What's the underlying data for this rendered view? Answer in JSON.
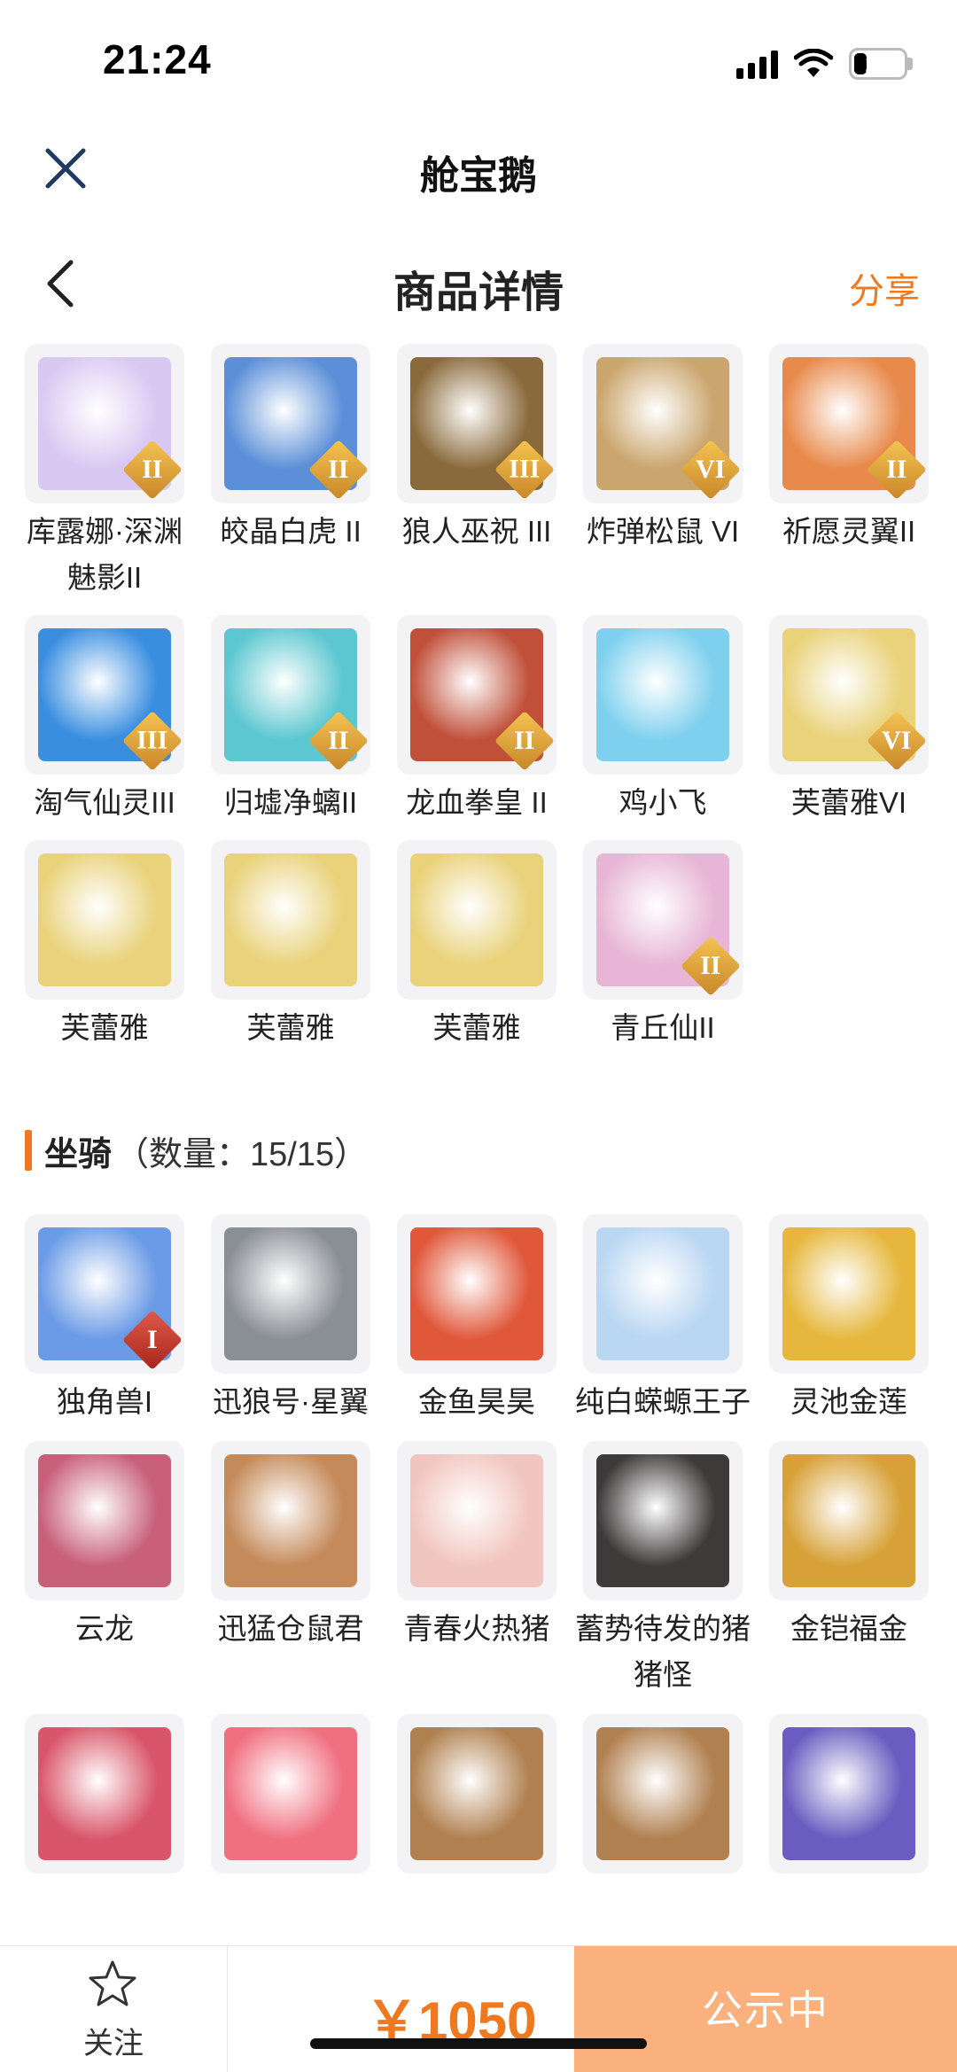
{
  "status": {
    "time": "21:24",
    "battery": "27"
  },
  "app": {
    "title": "舱宝鹅"
  },
  "nav": {
    "title": "商品详情",
    "share": "分享"
  },
  "pets": [
    {
      "name": "库露娜·深渊魅影II",
      "badge": "II",
      "icon": "pet-portrait",
      "color": "#d9c8f2"
    },
    {
      "name": "皎晶白虎 II",
      "badge": "II",
      "icon": "pet-portrait",
      "color": "#5b8fd8"
    },
    {
      "name": "狼人巫祝 III",
      "badge": "III",
      "icon": "pet-portrait",
      "color": "#8a6a3c"
    },
    {
      "name": "炸弹松鼠 VI",
      "badge": "VI",
      "icon": "pet-portrait",
      "color": "#caa56d"
    },
    {
      "name": "祈愿灵翼II",
      "badge": "II",
      "icon": "pet-portrait",
      "color": "#e88a4c"
    },
    {
      "name": "淘气仙灵III",
      "badge": "III",
      "icon": "pet-portrait",
      "color": "#3a8ee0"
    },
    {
      "name": "归墟净螭II",
      "badge": "II",
      "icon": "pet-portrait",
      "color": "#5cc7d0"
    },
    {
      "name": "龙血拳皇 II",
      "badge": "II",
      "icon": "pet-portrait",
      "color": "#c0503a"
    },
    {
      "name": "鸡小飞",
      "badge": "",
      "icon": "pet-portrait",
      "color": "#7fd0ee"
    },
    {
      "name": "芙蕾雅VI",
      "badge": "VI",
      "icon": "pet-portrait",
      "color": "#e9d27a"
    },
    {
      "name": "芙蕾雅",
      "badge": "",
      "icon": "pet-portrait",
      "color": "#e9d27a"
    },
    {
      "name": "芙蕾雅",
      "badge": "",
      "icon": "pet-portrait",
      "color": "#e9d27a"
    },
    {
      "name": "芙蕾雅",
      "badge": "",
      "icon": "pet-portrait",
      "color": "#e9d27a"
    },
    {
      "name": "青丘仙II",
      "badge": "II",
      "icon": "pet-portrait",
      "color": "#e7b6d6"
    }
  ],
  "mount_section": {
    "label": "坐骑",
    "count": "（数量：15/15）"
  },
  "mounts": [
    {
      "name": "独角兽I",
      "badge": "I",
      "icon": "mount-portrait",
      "color": "#6b9be6"
    },
    {
      "name": "迅狼号·星翼",
      "badge": "",
      "icon": "mount-portrait",
      "color": "#8a8f96"
    },
    {
      "name": "金鱼昊昊",
      "badge": "",
      "icon": "mount-portrait",
      "color": "#e0573a"
    },
    {
      "name": "纯白蝾螈王子",
      "badge": "",
      "icon": "mount-portrait",
      "color": "#b9d6f2"
    },
    {
      "name": "灵池金莲",
      "badge": "",
      "icon": "mount-portrait",
      "color": "#e6b73c"
    },
    {
      "name": "云龙",
      "badge": "",
      "icon": "mount-portrait",
      "color": "#c8607a"
    },
    {
      "name": "迅猛仓鼠君",
      "badge": "",
      "icon": "mount-portrait",
      "color": "#c48a5a"
    },
    {
      "name": "青春火热猪",
      "badge": "",
      "icon": "mount-portrait",
      "color": "#f2c6c0"
    },
    {
      "name": "蓄势待发的猪猪怪",
      "badge": "",
      "icon": "mount-portrait",
      "color": "#3e3a3a"
    },
    {
      "name": "金铠福金",
      "badge": "",
      "icon": "mount-portrait",
      "color": "#d7a137"
    },
    {
      "name": "",
      "badge": "",
      "icon": "mount-portrait",
      "color": "#d9566a"
    },
    {
      "name": "",
      "badge": "",
      "icon": "mount-portrait",
      "color": "#f07080"
    },
    {
      "name": "",
      "badge": "",
      "icon": "mount-portrait",
      "color": "#b08050"
    },
    {
      "name": "",
      "badge": "",
      "icon": "mount-portrait",
      "color": "#b08050"
    },
    {
      "name": "",
      "badge": "",
      "icon": "mount-portrait",
      "color": "#6a5cc0"
    }
  ],
  "footer": {
    "follow": "关注",
    "price": "￥1050",
    "status": "公示中"
  },
  "colors": {
    "accent": "#f0781e",
    "status_button": "#fbb17e"
  }
}
